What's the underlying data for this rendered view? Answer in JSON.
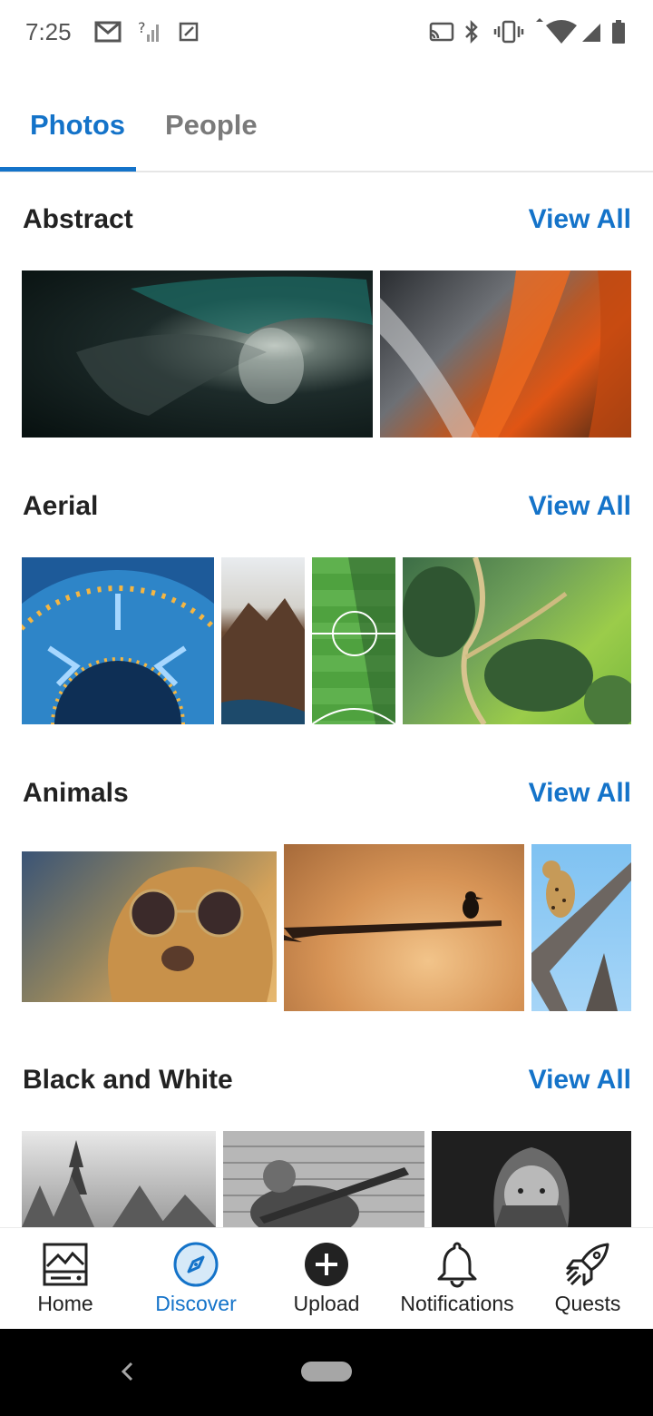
{
  "status_bar": {
    "time": "7:25",
    "icons_left": [
      "gmail-icon",
      "no-signal-icon",
      "screenshot-icon"
    ],
    "icons_right": [
      "cast-icon",
      "bluetooth-icon",
      "vibrate-icon",
      "wifi-icon",
      "cell-signal-icon",
      "battery-icon"
    ]
  },
  "tabs": [
    {
      "label": "Photos",
      "active": true
    },
    {
      "label": "People",
      "active": false
    }
  ],
  "sections": [
    {
      "title": "Abstract",
      "view_all": "View All"
    },
    {
      "title": "Aerial",
      "view_all": "View All"
    },
    {
      "title": "Animals",
      "view_all": "View All"
    },
    {
      "title": "Black and White",
      "view_all": "View All"
    }
  ],
  "bottom_nav": [
    {
      "label": "Home",
      "icon": "home-image-icon",
      "active": false
    },
    {
      "label": "Discover",
      "icon": "compass-icon",
      "active": true
    },
    {
      "label": "Upload",
      "icon": "plus-circle-icon",
      "active": false
    },
    {
      "label": "Notifications",
      "icon": "bell-icon",
      "active": false
    },
    {
      "label": "Quests",
      "icon": "rocket-icon",
      "active": false
    }
  ],
  "colors": {
    "accent": "#1473c9",
    "inactive_tab": "#7a7a7a",
    "text": "#222222"
  }
}
